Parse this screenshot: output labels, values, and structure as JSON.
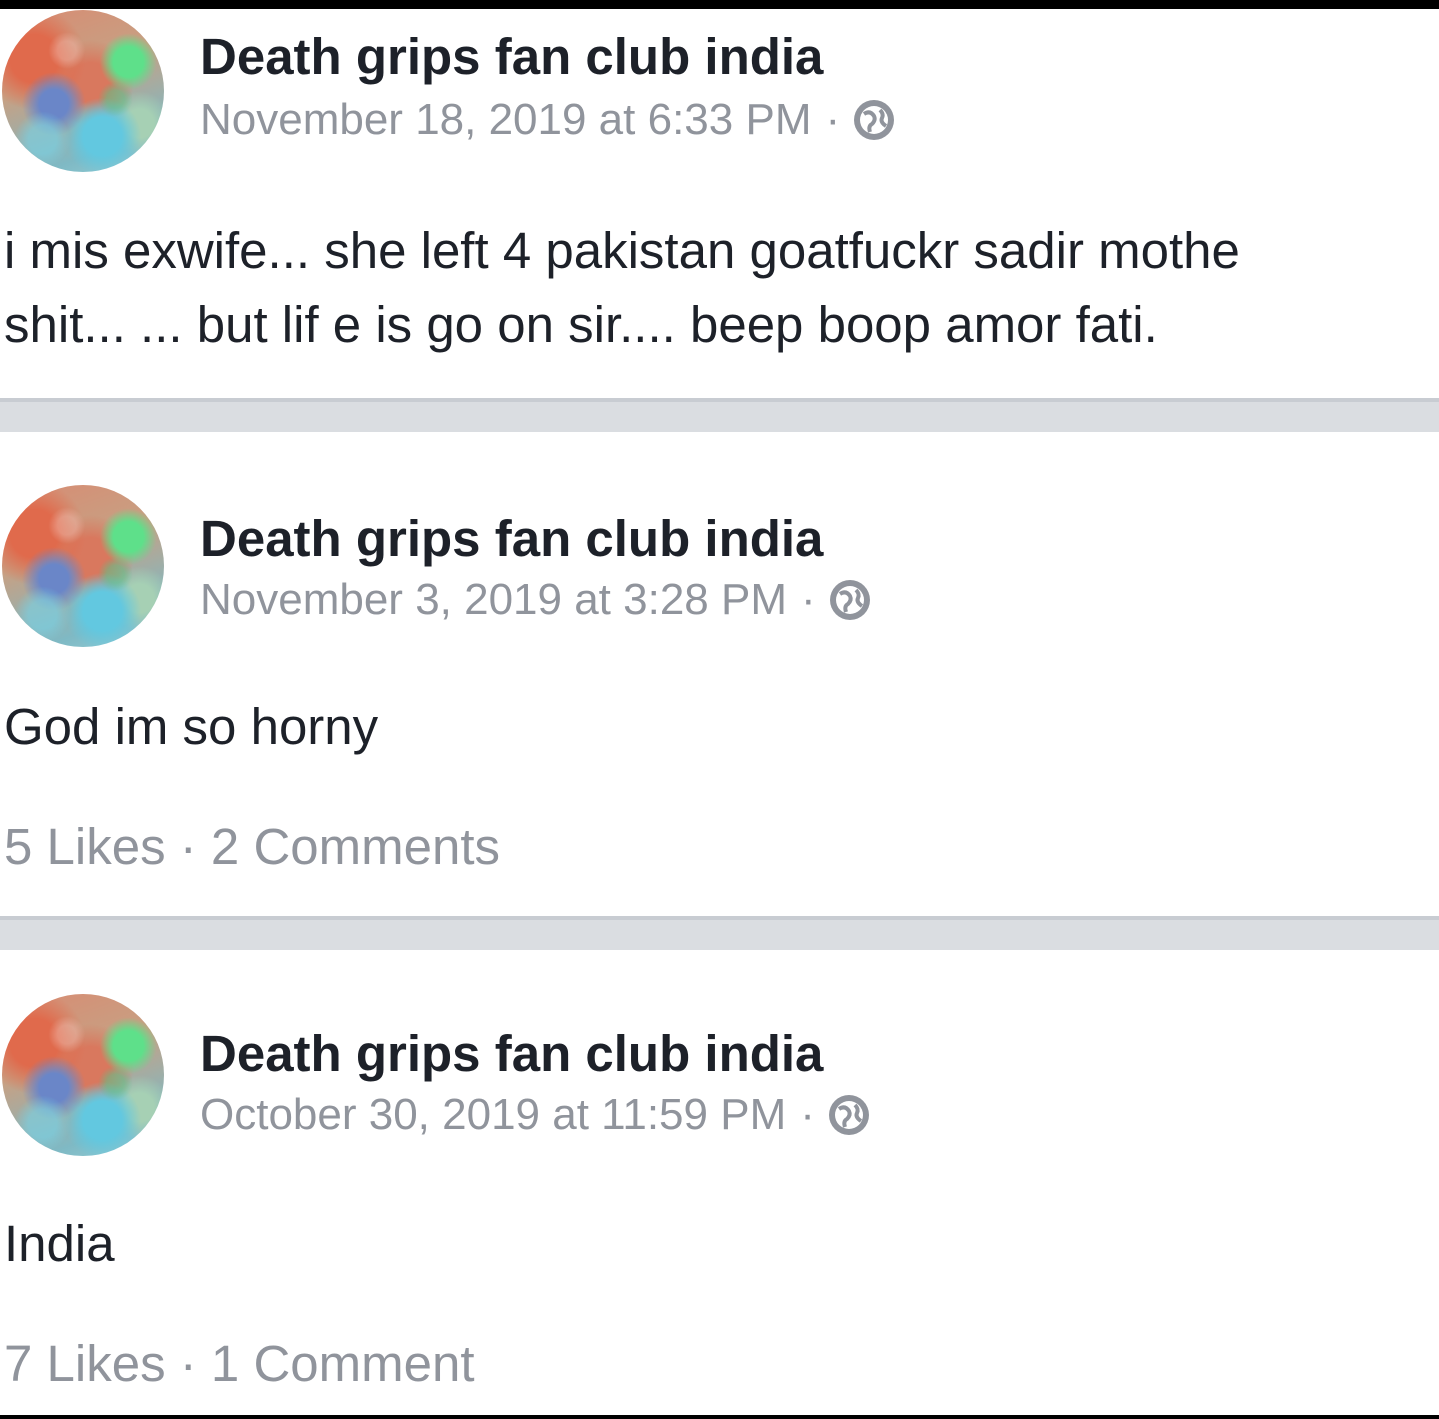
{
  "posts": [
    {
      "author": "Death grips fan club india",
      "timestamp": "November 18, 2019 at 6:33 PM",
      "separator": "·",
      "text_lines": [
        "i mis exwife... she left 4 pakistan goatfuckr sadir mothe",
        "shit... ... but lif e is go on sir.... beep boop amor fati."
      ],
      "privacy_icon": "globe-icon"
    },
    {
      "author": "Death grips fan club india",
      "timestamp": "November 3, 2019 at 3:28 PM",
      "separator": "·",
      "text_lines": [
        "God im so horny"
      ],
      "privacy_icon": "globe-icon",
      "stats": "5 Likes · 2 Comments"
    },
    {
      "author": "Death grips fan club india",
      "timestamp": "October 30, 2019 at 11:59 PM",
      "separator": "·",
      "text_lines": [
        "India"
      ],
      "privacy_icon": "globe-icon",
      "stats": "7 Likes · 1 Comment"
    }
  ],
  "colors": {
    "name": "#1d2129",
    "meta": "#90949c",
    "divider": "#dadde1"
  }
}
